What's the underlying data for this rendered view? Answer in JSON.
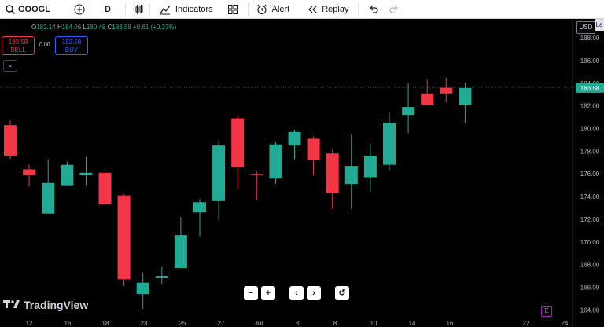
{
  "toolbar": {
    "symbol": "GOOGL",
    "interval": "D",
    "indicators_label": "Indicators",
    "alert_label": "Alert",
    "replay_label": "Replay"
  },
  "legend": {
    "open_key": "O",
    "open": "182.14",
    "high_key": "H",
    "high": "184.06",
    "low_key": "L",
    "low": "180.48",
    "close_key": "C",
    "close": "183.58",
    "change": "+0.61 (+0.33%)"
  },
  "trade": {
    "sell_price": "183.58",
    "sell_label": "SELL",
    "spread": "0.00",
    "buy_price": "183.58",
    "buy_label": "BUY"
  },
  "currency": "USD",
  "la_tab": "La",
  "last_price_label": "183.58",
  "brand": "TradingView",
  "earnings_badge": "E",
  "colors": {
    "up": "#22ab94",
    "down": "#f23645",
    "background": "#000000",
    "last_price": "#22ab94"
  },
  "chart_data": {
    "type": "candlestick",
    "y_ticks": [
      164,
      166,
      168,
      170,
      172,
      174,
      176,
      178,
      180,
      182,
      184,
      186,
      188
    ],
    "ylim": [
      163.4,
      189.6
    ],
    "x_labels": [
      "12",
      "16",
      "18",
      "23",
      "25",
      "27",
      "Jul",
      "3",
      "8",
      "10",
      "14",
      "16",
      "22",
      "24"
    ],
    "candles": [
      {
        "o": 180.3,
        "h": 180.7,
        "l": 177.3,
        "c": 177.6
      },
      {
        "o": 176.4,
        "h": 176.8,
        "l": 174.9,
        "c": 175.9
      },
      {
        "o": 172.5,
        "h": 177.3,
        "l": 172.5,
        "c": 175.2
      },
      {
        "o": 175.0,
        "h": 177.1,
        "l": 175.0,
        "c": 176.8
      },
      {
        "o": 175.9,
        "h": 177.5,
        "l": 175.0,
        "c": 176.1
      },
      {
        "o": 176.1,
        "h": 176.4,
        "l": 173.3,
        "c": 173.3
      },
      {
        "o": 174.1,
        "h": 174.2,
        "l": 166.1,
        "c": 166.7
      },
      {
        "o": 165.4,
        "h": 167.3,
        "l": 164.1,
        "c": 166.4
      },
      {
        "o": 166.8,
        "h": 167.8,
        "l": 166.3,
        "c": 167.0
      },
      {
        "o": 167.7,
        "h": 172.2,
        "l": 167.7,
        "c": 170.6
      },
      {
        "o": 172.6,
        "h": 173.8,
        "l": 170.5,
        "c": 173.5
      },
      {
        "o": 173.6,
        "h": 179.0,
        "l": 171.9,
        "c": 178.5
      },
      {
        "o": 180.9,
        "h": 181.2,
        "l": 174.6,
        "c": 176.6
      },
      {
        "o": 176.0,
        "h": 176.2,
        "l": 173.7,
        "c": 175.9
      },
      {
        "o": 175.6,
        "h": 178.8,
        "l": 175.1,
        "c": 178.6
      },
      {
        "o": 178.5,
        "h": 179.9,
        "l": 177.3,
        "c": 179.7
      },
      {
        "o": 179.1,
        "h": 179.3,
        "l": 175.9,
        "c": 177.2
      },
      {
        "o": 177.8,
        "h": 178.1,
        "l": 172.9,
        "c": 174.3
      },
      {
        "o": 175.1,
        "h": 179.5,
        "l": 172.9,
        "c": 176.7
      },
      {
        "o": 175.7,
        "h": 178.7,
        "l": 174.4,
        "c": 177.6
      },
      {
        "o": 176.8,
        "h": 181.4,
        "l": 176.3,
        "c": 180.5
      },
      {
        "o": 181.2,
        "h": 184.0,
        "l": 179.6,
        "c": 181.9
      },
      {
        "o": 183.1,
        "h": 184.3,
        "l": 182.2,
        "c": 182.1
      },
      {
        "o": 183.6,
        "h": 184.5,
        "l": 182.3,
        "c": 183.1
      },
      {
        "o": 182.1,
        "h": 184.06,
        "l": 180.48,
        "c": 183.58
      }
    ]
  }
}
